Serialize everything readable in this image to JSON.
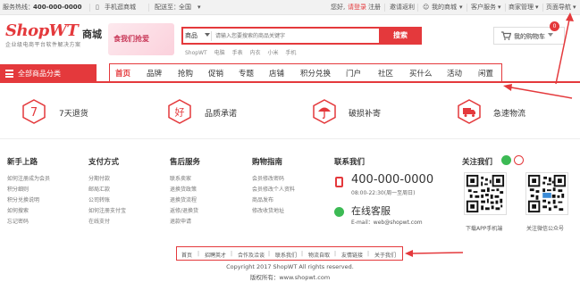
{
  "topbar": {
    "service_label": "服务热线：",
    "hotline": "400-000-0000",
    "mobile_mall": "手机逛商城",
    "delivery_label": "配送至：",
    "delivery_region": "全国",
    "greeting": "您好,",
    "login": "请登录",
    "register": "注册",
    "invite": "邀请返利",
    "my_mall": "我的商城",
    "customer_service": "客户服务",
    "merchant_admin": "商家管理",
    "page_nav": "页面导航"
  },
  "header": {
    "logo": "ShopWT",
    "logo_suffix": "商城",
    "tagline": "企业级电商平台软件解决方案",
    "banner_text": "食我们抢爱",
    "search": {
      "category": "商品",
      "placeholder": "请输入您要搜索的商品关键字",
      "button": "搜索",
      "hot_words": [
        "ShopWT",
        "电脑",
        "手表",
        "内衣",
        "小米",
        "手机"
      ]
    },
    "cart": {
      "label": "我的购物车",
      "count": "0"
    }
  },
  "nav": {
    "all_categories": "全部商品分类",
    "items": [
      "首页",
      "品牌",
      "抢购",
      "促销",
      "专题",
      "店铺",
      "积分兑换",
      "门户",
      "社区",
      "买什么",
      "活动",
      "闲置"
    ]
  },
  "services": [
    {
      "icon": "7",
      "label": "7天退货"
    },
    {
      "icon": "好",
      "label": "品质承诺"
    },
    {
      "icon": "umbrella-icon",
      "label": "破损补寄"
    },
    {
      "icon": "truck-icon",
      "label": "急速物流"
    }
  ],
  "footer_columns": [
    {
      "title": "新手上路",
      "links": [
        "如何注册成为会员",
        "积分细则",
        "积分兑换说明",
        "如何搜索",
        "忘记密码"
      ]
    },
    {
      "title": "支付方式",
      "links": [
        "分期付款",
        "邮局汇款",
        "公司转账",
        "如何注册支付宝",
        "在线支付"
      ]
    },
    {
      "title": "售后服务",
      "links": [
        "联系卖家",
        "退换货政策",
        "退换货流程",
        "返修/退换货",
        "退款申请"
      ]
    },
    {
      "title": "购物指南",
      "links": [
        "会员修改密码",
        "会员修改个人资料",
        "商品发布",
        "修改收货地址"
      ]
    }
  ],
  "contact": {
    "title": "联系我们",
    "phone": "400-000-0000",
    "hours": "08:00-22:30(周一至周日)",
    "online_service": "在线客服",
    "email": "E-mail：web@shopwt.com"
  },
  "follow": {
    "title": "关注我们",
    "qr_codes": [
      {
        "caption": "下载APP手机端"
      },
      {
        "caption": "关注微信公众号"
      }
    ]
  },
  "bottom_links": [
    "首页",
    "招聘英才",
    "合作及洽谈",
    "联系我们",
    "物流自取",
    "友情链接",
    "关于我们"
  ],
  "copyright": "Copyright 2017 ShopWT All rights reserved.",
  "owner": "版权所有：www.shopwt.com",
  "colors": {
    "accent": "#e4393c",
    "wechat": "#3cba54"
  }
}
